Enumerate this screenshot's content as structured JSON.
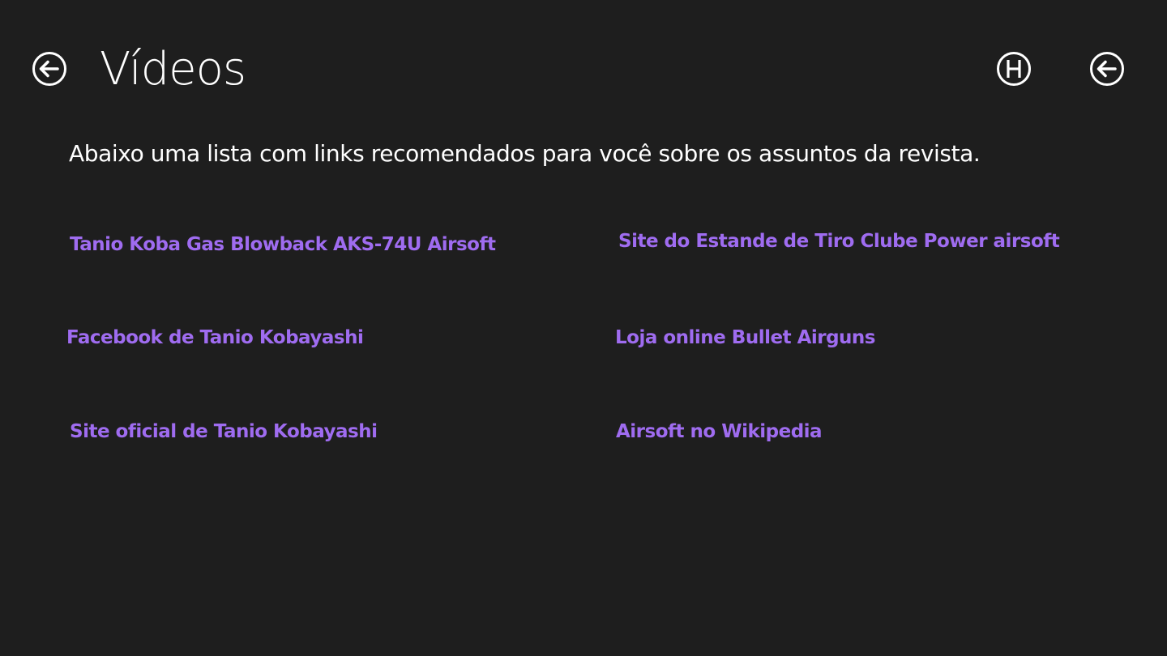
{
  "header": {
    "title": "Vídeos",
    "back_icon": "arrow-left-circle-icon",
    "home_icon": "h-circle-icon",
    "close_icon": "arrow-left-circle-icon"
  },
  "intro": "Abaixo uma lista com links recomendados para você sobre os assuntos da revista.",
  "links": [
    {
      "label": "Tanio Koba Gas Blowback AKS-74U Airsoft"
    },
    {
      "label": "Site do Estande de Tiro Clube Power airsoft"
    },
    {
      "label": "Facebook de Tanio Kobayashi"
    },
    {
      "label": "Loja online Bullet Airguns"
    },
    {
      "label": "Site oficial de Tanio Kobayashi"
    },
    {
      "label": "Airsoft no Wikipedia"
    }
  ],
  "colors": {
    "background": "#1e1e1e",
    "text": "#ffffff",
    "link": "#9f6cf0"
  }
}
